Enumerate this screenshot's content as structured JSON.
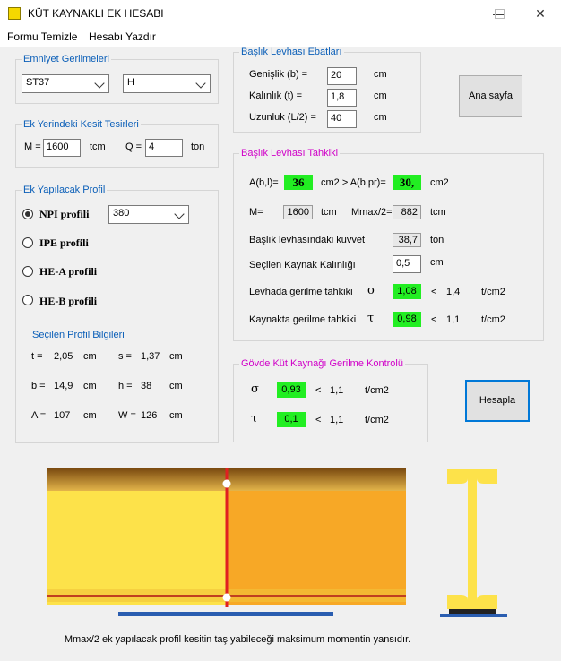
{
  "window": {
    "title": "KÜT KAYNAKLI EK HESABI",
    "minimize": "—",
    "maximize": "☐",
    "close": "✕"
  },
  "menu": {
    "clear": "Formu Temizle",
    "print": "Hesabı Yazdır"
  },
  "emniyet": {
    "title": "Emniyet Gerilmeleri",
    "steel": "ST37",
    "load": "H"
  },
  "kesit": {
    "title": "Ek Yerindeki Kesit Tesirleri",
    "m_label": "M =",
    "m_value": "1600",
    "m_unit": "tcm",
    "q_label": "Q =",
    "q_value": "4",
    "q_unit": "ton"
  },
  "profil": {
    "title": "Ek Yapılacak Profil",
    "options": [
      "NPI profili",
      "IPE profili",
      "HE-A profili",
      "HE-B profili"
    ],
    "selected_size": "380",
    "info_title": "Seçilen Profil Bilgileri",
    "t_label": "t =",
    "t_value": "2,05",
    "t_unit": "cm",
    "s_label": "s =",
    "s_value": "1,37",
    "s_unit": "cm",
    "b_label": "b =",
    "b_value": "14,9",
    "b_unit": "cm",
    "h_label": "h =",
    "h_value": "38",
    "h_unit": "cm",
    "a_label": "A =",
    "a_value": "107",
    "a_unit": "cm",
    "w_label": "W =",
    "w_value": "126",
    "w_unit": "cm"
  },
  "levha": {
    "title": "Başlık Levhası Ebatları",
    "gen_label": "Genişlik (b) =",
    "gen_value": "20",
    "gen_unit": "cm",
    "kal_label": "Kalınlık (t) =",
    "kal_value": "1,8",
    "kal_unit": "cm",
    "uzun_label": "Uzunluk (L/2) =",
    "uzun_value": "40",
    "uzun_unit": "cm"
  },
  "ana_sayfa": "Ana sayfa",
  "tahkik": {
    "title": "Başlık Levhası Tahkiki",
    "abl_label": "A(b,l)=",
    "abl_value": "36",
    "mid_label": "cm2 > A(b,pr)=",
    "abpr_value": "30,",
    "abpr_unit": "cm2",
    "m_label": "M=",
    "m_value": "1600",
    "m_unit": "tcm",
    "mmax_label": "Mmax/2=",
    "mmax_value": "882",
    "mmax_unit": "tcm",
    "kuvvet_label": "Başlık levhasındaki kuvvet",
    "kuvvet_value": "38,7",
    "kuvvet_unit": "ton",
    "kaynak_label": "Seçilen Kaynak Kalınlığı",
    "kaynak_value": "0,5",
    "kaynak_unit": "cm",
    "levha_label": "Levhada gerilme tahkiki",
    "sigma": "σ",
    "levha_value": "1,08",
    "lt": "<",
    "levha_limit": "1,4",
    "stress_unit": "t/cm2",
    "kaynakta_label": "Kaynakta gerilme tahkiki",
    "tau": "τ",
    "kaynakta_value": "0,98",
    "kaynakta_limit": "1,1"
  },
  "govde": {
    "title": "Gövde Küt Kaynağı Gerilme Kontrolü",
    "sigma": "σ",
    "sigma_value": "0,93",
    "sigma_limit": "1,1",
    "tau": "τ",
    "tau_value": "0,1",
    "tau_limit": "1,1",
    "lt": "<",
    "unit": "t/cm2"
  },
  "hesapla": "Hesapla",
  "footer_note": "Mmax/2 ek yapılacak profil kesitin taşıyabileceği maksimum momentin yansıdır.",
  "colors": {
    "ok": "#22ee22",
    "beam_light": "#fde24a",
    "beam_dark": "#f5a623",
    "weld": "#e02020",
    "plate": "#2a5db0"
  }
}
